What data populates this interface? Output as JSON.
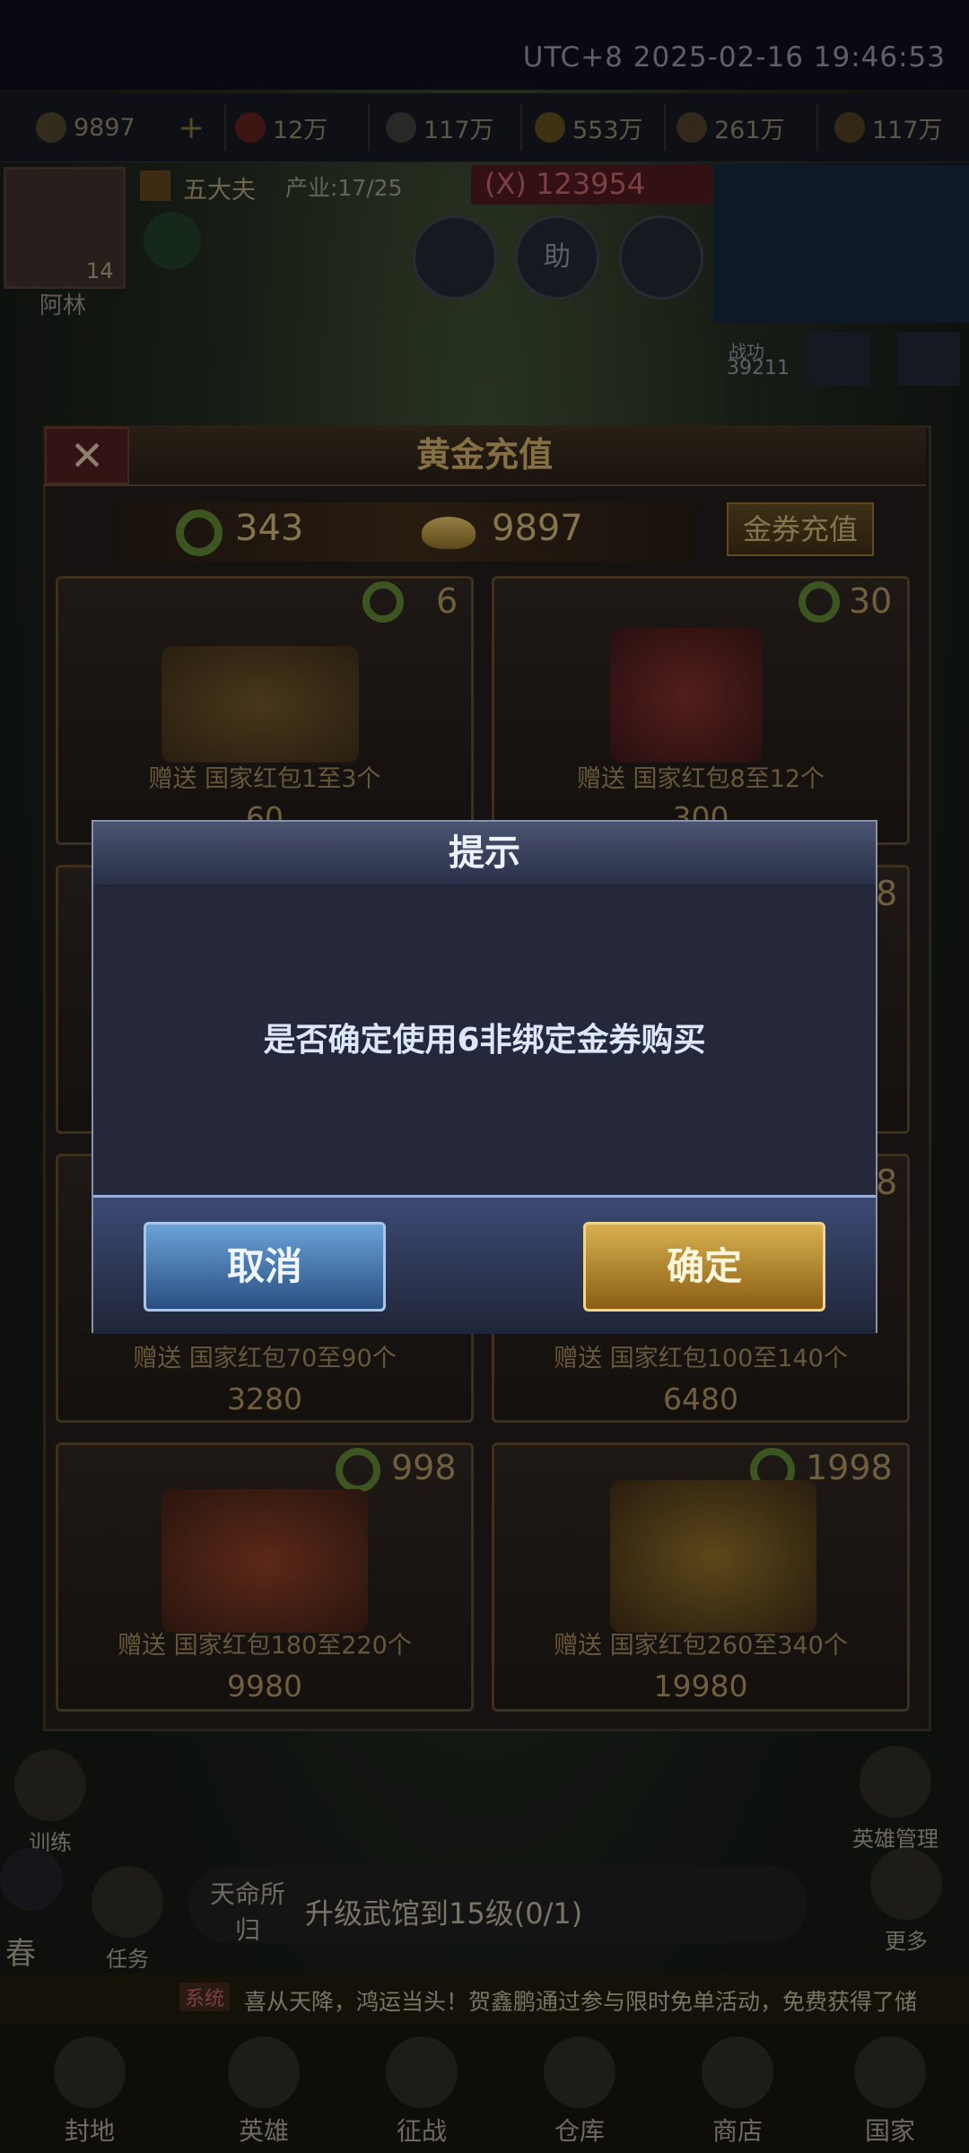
{
  "clock": "UTC+8 2025-02-16 19:46:53",
  "resources": [
    "9897",
    "12万",
    "117万",
    "553万",
    "261万",
    "117万"
  ],
  "player": {
    "name": "阿林",
    "level": "14",
    "rank": "五大夫",
    "industry": "产业:17/25",
    "power": "(X) 123954"
  },
  "help_label": "助",
  "battle": {
    "label": "战功",
    "value": "39211"
  },
  "recharge": {
    "title": "黄金充值",
    "close_icon": "close-icon",
    "jade_balance": "343",
    "gold_balance": "9897",
    "ticket_button": "金券充值",
    "cards": [
      {
        "price": "6",
        "gift": "赠送 国家红包1至3个",
        "gold": "60"
      },
      {
        "price": "30",
        "gift": "赠送 国家红包8至12个",
        "gold": "300"
      },
      {
        "price": "",
        "gift": "",
        "gold": ""
      },
      {
        "price": "8",
        "gift": "",
        "gold": ""
      },
      {
        "price": "",
        "gift": "赠送 国家红包70至90个",
        "gold": "3280"
      },
      {
        "price": "8",
        "gift": "赠送 国家红包100至140个",
        "gold": "6480"
      },
      {
        "price": "998",
        "gift": "赠送 国家红包180至220个",
        "gold": "9980"
      },
      {
        "price": "1998",
        "gift": "赠送 国家红包260至340个",
        "gold": "19980"
      }
    ]
  },
  "modal": {
    "title": "提示",
    "message": "是否确定使用6非绑定金券购买",
    "cancel": "取消",
    "confirm": "确定"
  },
  "hud": {
    "task_text": "升级武馆到15级(0/1)",
    "destiny": "天命所归",
    "task_label": "任务",
    "train_label": "训练",
    "hero_manage": "英雄管理",
    "more": "更多",
    "spring": "春",
    "ticker_tag": "系统",
    "ticker": "喜从天降，鸿运当头！贺鑫鹏通过参与限时免单活动，免费获得了储"
  },
  "nav": [
    "封地",
    "英雄",
    "征战",
    "仓库",
    "商店",
    "国家"
  ]
}
